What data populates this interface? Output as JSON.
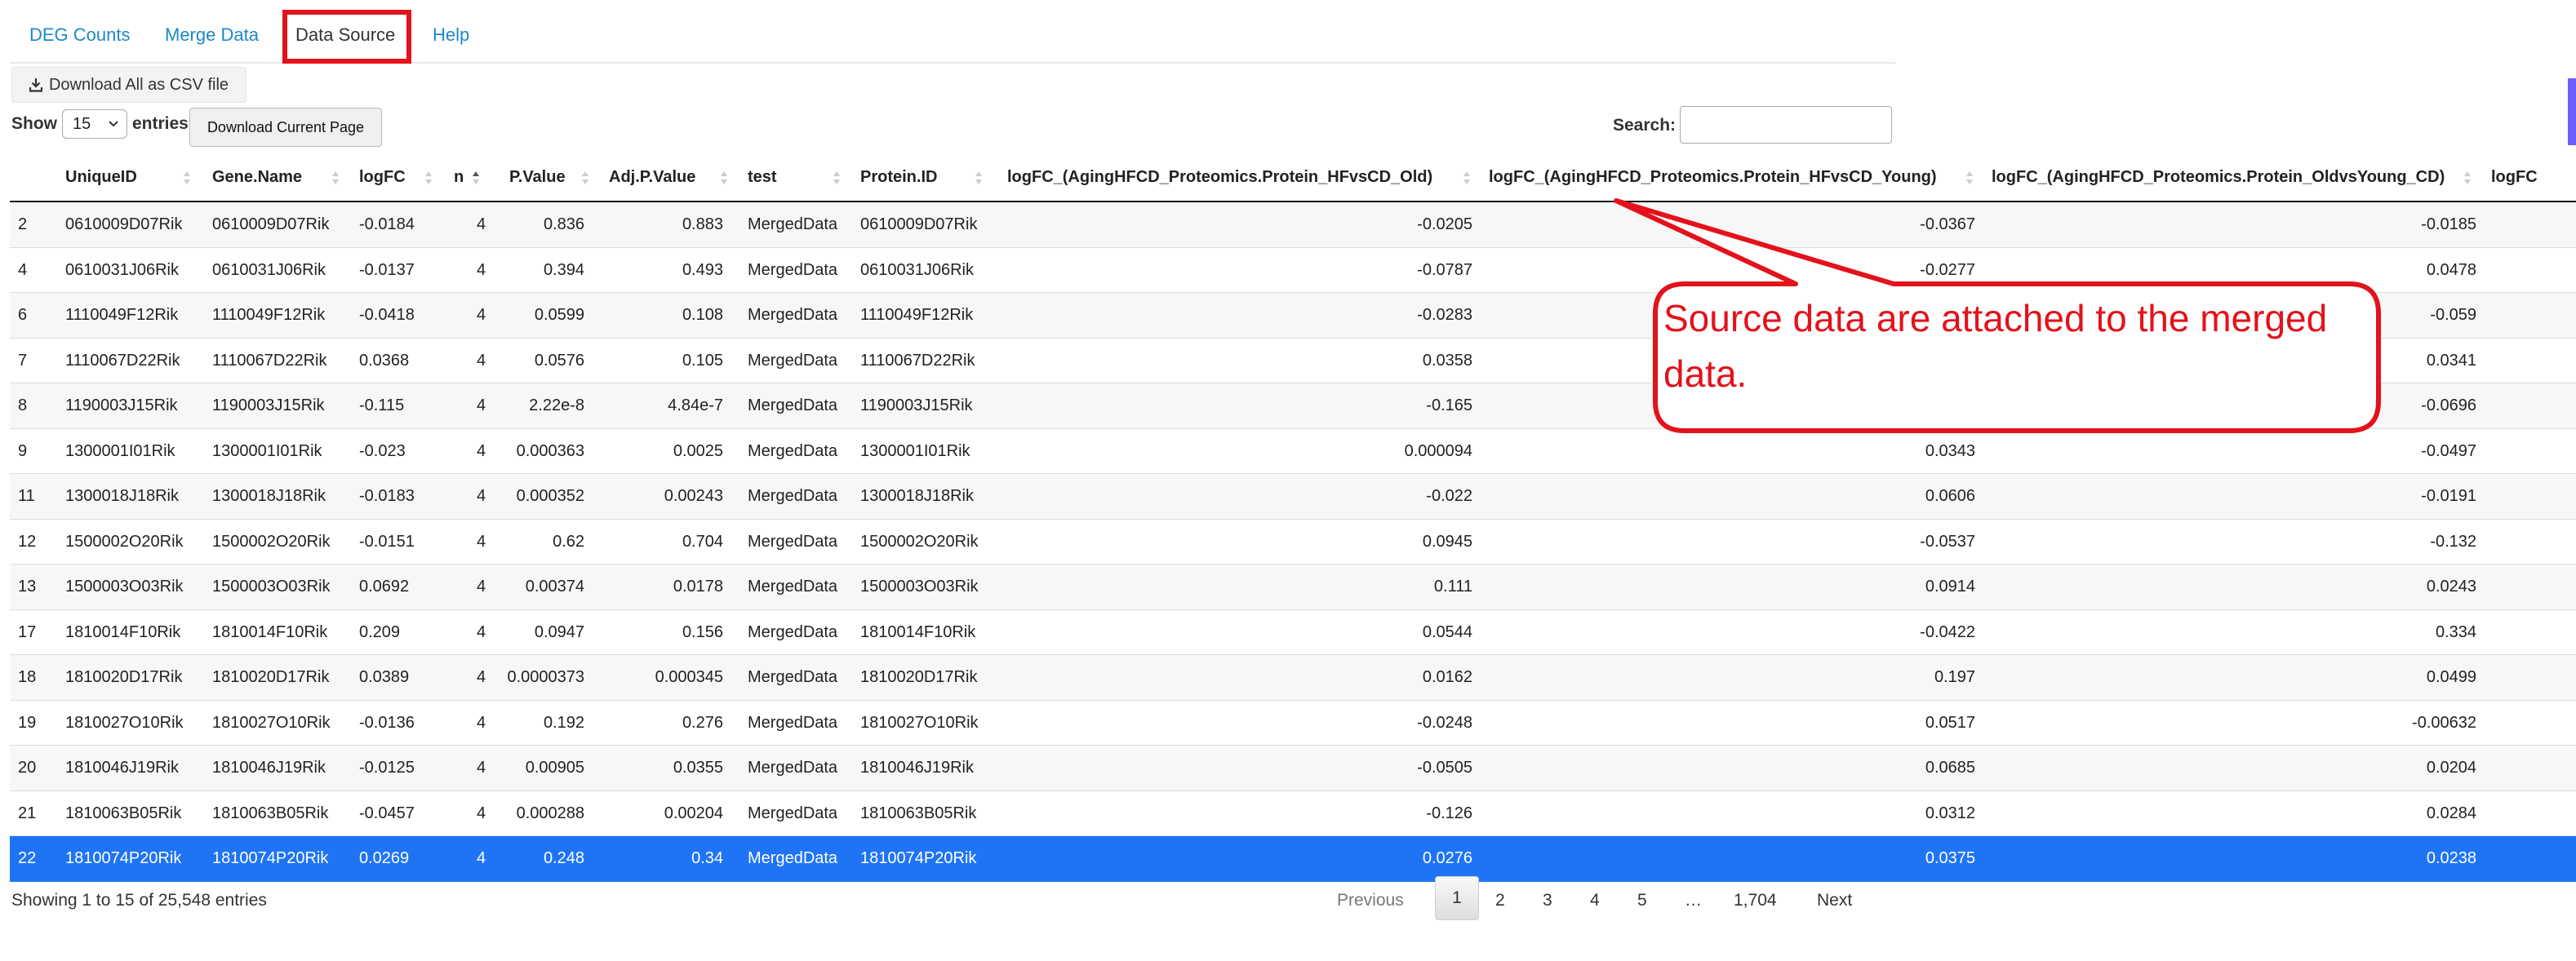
{
  "tabs": [
    {
      "label": "DEG Counts"
    },
    {
      "label": "Merge Data"
    },
    {
      "label": "Data Source",
      "active": true
    },
    {
      "label": "Help"
    }
  ],
  "toolbar": {
    "download_all_label": "Download All as CSV file",
    "download_icon": "download-icon",
    "download_current_label": "Download Current Page"
  },
  "length_control": {
    "show_label": "Show",
    "entries_label": "entries",
    "selected": "15"
  },
  "search": {
    "label": "Search:",
    "value": ""
  },
  "table": {
    "columns": [
      "",
      "UniqueID",
      "Gene.Name",
      "logFC",
      "n",
      "P.Value",
      "Adj.P.Value",
      "test",
      "Protein.ID",
      "logFC_(AgingHFCD_Proteomics.Protein_HFvsCD_Old)",
      "logFC_(AgingHFCD_Proteomics.Protein_HFvsCD_Young)",
      "logFC_(AgingHFCD_Proteomics.Protein_OldvsYoung_CD)",
      "logFC"
    ],
    "sorted_column": "n",
    "rows": [
      [
        "2",
        "0610009D07Rik",
        "0610009D07Rik",
        "-0.0184",
        "4",
        "0.836",
        "0.883",
        "MergedData",
        "0610009D07Rik",
        "-0.0205",
        "-0.0367",
        "-0.0185"
      ],
      [
        "4",
        "0610031J06Rik",
        "0610031J06Rik",
        "-0.0137",
        "4",
        "0.394",
        "0.493",
        "MergedData",
        "0610031J06Rik",
        "-0.0787",
        "-0.0277",
        "0.0478"
      ],
      [
        "6",
        "1110049F12Rik",
        "1110049F12Rik",
        "-0.0418",
        "4",
        "0.0599",
        "0.108",
        "MergedData",
        "1110049F12Rik",
        "-0.0283",
        "",
        "-0.059"
      ],
      [
        "7",
        "1110067D22Rik",
        "1110067D22Rik",
        "0.0368",
        "4",
        "0.0576",
        "0.105",
        "MergedData",
        "1110067D22Rik",
        "0.0358",
        "",
        "0.0341"
      ],
      [
        "8",
        "1190003J15Rik",
        "1190003J15Rik",
        "-0.115",
        "4",
        "2.22e-8",
        "4.84e-7",
        "MergedData",
        "1190003J15Rik",
        "-0.165",
        "",
        "-0.0696"
      ],
      [
        "9",
        "1300001I01Rik",
        "1300001I01Rik",
        "-0.023",
        "4",
        "0.000363",
        "0.0025",
        "MergedData",
        "1300001I01Rik",
        "0.000094",
        "0.0343",
        "-0.0497"
      ],
      [
        "11",
        "1300018J18Rik",
        "1300018J18Rik",
        "-0.0183",
        "4",
        "0.000352",
        "0.00243",
        "MergedData",
        "1300018J18Rik",
        "-0.022",
        "0.0606",
        "-0.0191"
      ],
      [
        "12",
        "1500002O20Rik",
        "1500002O20Rik",
        "-0.0151",
        "4",
        "0.62",
        "0.704",
        "MergedData",
        "1500002O20Rik",
        "0.0945",
        "-0.0537",
        "-0.132"
      ],
      [
        "13",
        "1500003O03Rik",
        "1500003O03Rik",
        "0.0692",
        "4",
        "0.00374",
        "0.0178",
        "MergedData",
        "1500003O03Rik",
        "0.111",
        "0.0914",
        "0.0243"
      ],
      [
        "17",
        "1810014F10Rik",
        "1810014F10Rik",
        "0.209",
        "4",
        "0.0947",
        "0.156",
        "MergedData",
        "1810014F10Rik",
        "0.0544",
        "-0.0422",
        "0.334"
      ],
      [
        "18",
        "1810020D17Rik",
        "1810020D17Rik",
        "0.0389",
        "4",
        "0.0000373",
        "0.000345",
        "MergedData",
        "1810020D17Rik",
        "0.0162",
        "0.197",
        "0.0499"
      ],
      [
        "19",
        "1810027O10Rik",
        "1810027O10Rik",
        "-0.0136",
        "4",
        "0.192",
        "0.276",
        "MergedData",
        "1810027O10Rik",
        "-0.0248",
        "0.0517",
        "-0.00632"
      ],
      [
        "20",
        "1810046J19Rik",
        "1810046J19Rik",
        "-0.0125",
        "4",
        "0.00905",
        "0.0355",
        "MergedData",
        "1810046J19Rik",
        "-0.0505",
        "0.0685",
        "0.0204"
      ],
      [
        "21",
        "1810063B05Rik",
        "1810063B05Rik",
        "-0.0457",
        "4",
        "0.000288",
        "0.00204",
        "MergedData",
        "1810063B05Rik",
        "-0.126",
        "0.0312",
        "0.0284"
      ],
      [
        "22",
        "1810074P20Rik",
        "1810074P20Rik",
        "0.0269",
        "4",
        "0.248",
        "0.34",
        "MergedData",
        "1810074P20Rik",
        "0.0276",
        "0.0375",
        "0.0238"
      ]
    ],
    "selected_row": 14
  },
  "info": "Showing 1 to 15 of 25,548 entries",
  "pagination": {
    "previous": "Previous",
    "pages": [
      "1",
      "2",
      "3",
      "4",
      "5",
      "…",
      "1,704"
    ],
    "current": "1",
    "next": "Next"
  },
  "annotation": {
    "text": "Source data are attached to the merged data.",
    "color": "#e3121b"
  },
  "colors": {
    "link": "#1e88c8",
    "selected_row": "#1f74f6",
    "highlight": "#e3121b"
  }
}
